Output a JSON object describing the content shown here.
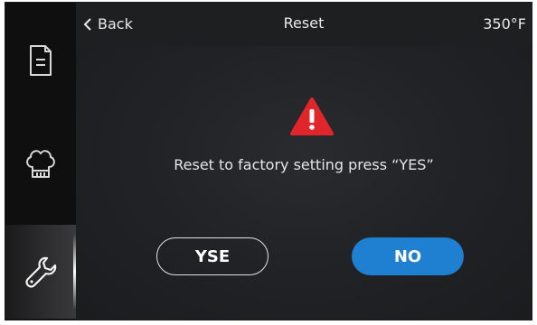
{
  "header": {
    "back_label": "Back",
    "title": "Reset",
    "temperature": "350°F"
  },
  "sidebar": {
    "items": [
      {
        "icon": "document-icon",
        "active": false
      },
      {
        "icon": "chef-hat-icon",
        "active": false
      },
      {
        "icon": "wrench-icon",
        "active": true
      }
    ]
  },
  "dialog": {
    "warning_icon": "warning-icon",
    "warning_color": "#e0262b",
    "message": "Reset to factory setting press “YES”",
    "yes_label": "YSE",
    "no_label": "NO"
  },
  "colors": {
    "accent": "#1f7fd0",
    "background": "#222326"
  }
}
